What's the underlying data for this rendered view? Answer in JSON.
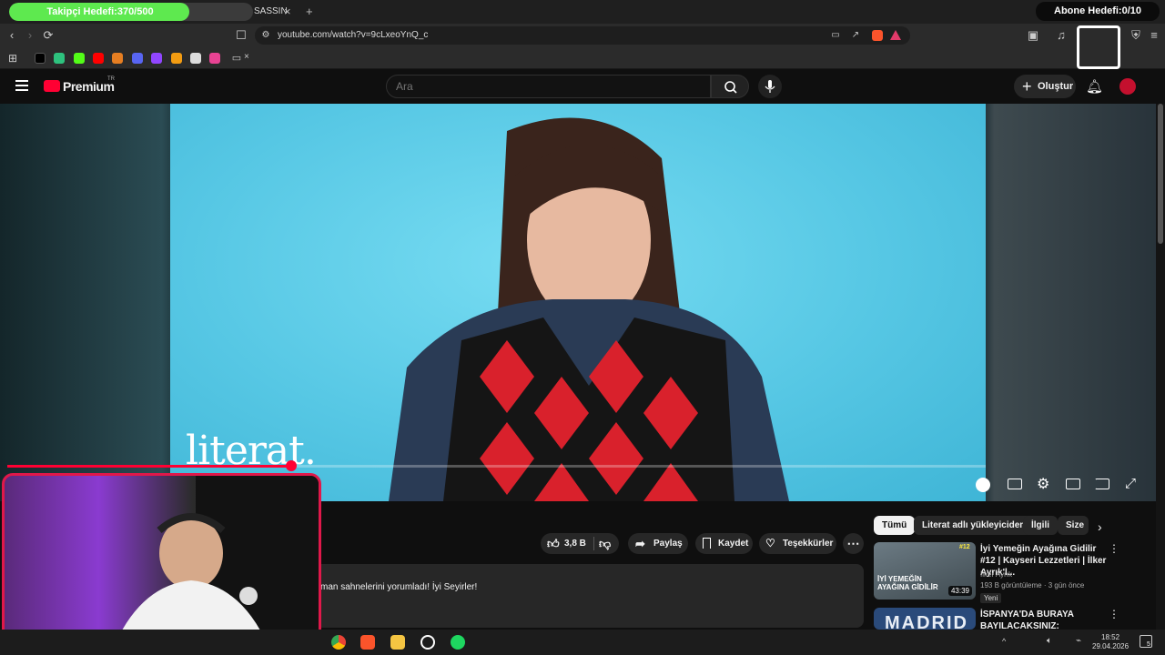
{
  "overlay": {
    "follower_goal": "Takipçi Hedefi:370/500",
    "follower_progress": 0.74,
    "subscriber_goal": "Abone Hedefi:0/10"
  },
  "browser": {
    "tab_title": "SASSIN",
    "tab_close": "×",
    "new_tab": "+",
    "url": "youtube.com/watch?v=9cLxeoYnQ_c",
    "bookmark_folder_x": "×"
  },
  "youtube": {
    "logo_text": "Premium",
    "logo_badge": "TR",
    "search_placeholder": "Ara",
    "create_label": "Oluştur"
  },
  "video": {
    "watermark": "literat.",
    "progress": 0.29
  },
  "actions": {
    "likes": "3,8 B",
    "share": "Paylaş",
    "save": "Kaydet",
    "thanks": "Teşekkürler"
  },
  "description": {
    "text": "man sahnelerini yorumladı! İyi Seyirler!"
  },
  "sidebar": {
    "chips": [
      "Tümü",
      "Literat adlı yükleyiciden",
      "İlgili",
      "Size"
    ],
    "recommendations": [
      {
        "title": "İyi Yemeğin Ayağına Gidilir #12 | Kayseri Lezzetleri | İlker Ayrık'l...",
        "channel": "İlker Ayrık",
        "meta": "193 B görüntüleme · 3 gün önce",
        "badge": "Yeni",
        "duration": "43:39",
        "thumb_text": "İYİ YEMEĞİN AYAĞINA GİDİLİR",
        "thumb_tag": "#12"
      },
      {
        "title": "İSPANYA'DA BURAYA BAYILACAKSINIZ: KRALLAR ...",
        "thumb_text": "MADRID"
      }
    ]
  },
  "taskbar": {
    "time": "18:52",
    "date": "29.04.2026",
    "notif_count": "5"
  }
}
